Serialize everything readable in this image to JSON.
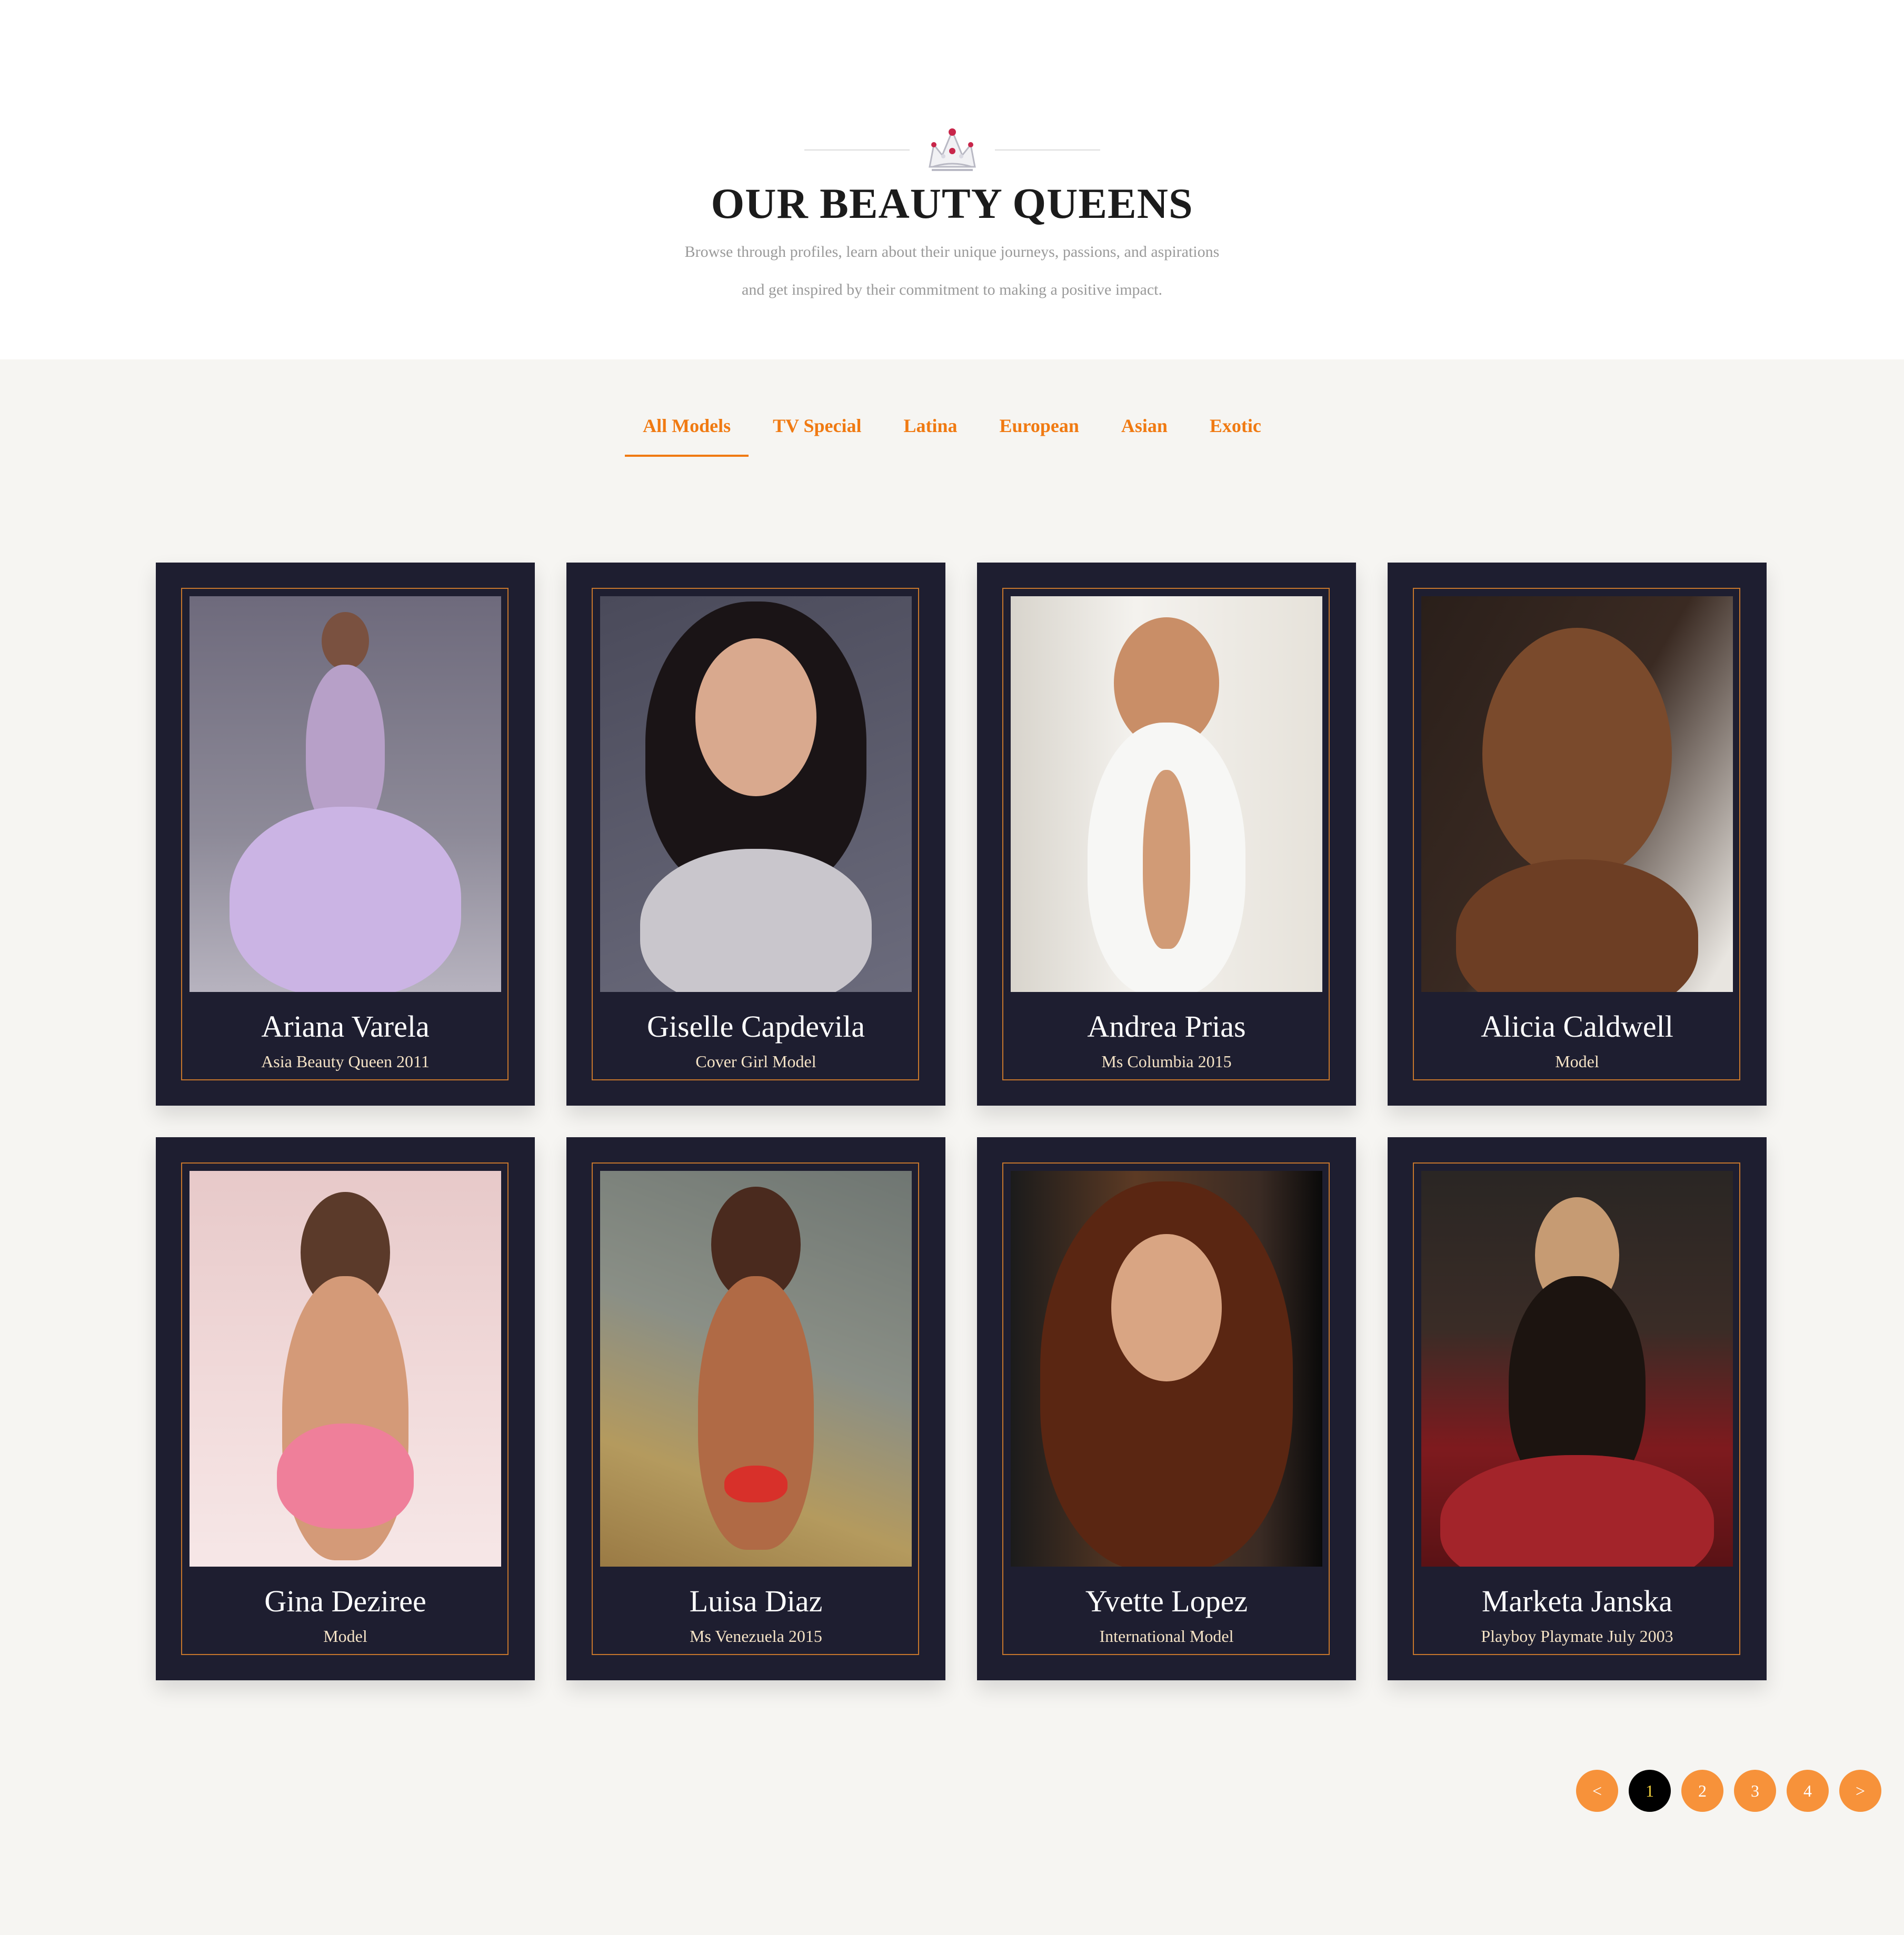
{
  "header": {
    "title": "OUR BEAUTY QUEENS",
    "subtitle_line1": "Browse through profiles, learn about their unique journeys, passions, and aspirations",
    "subtitle_line2": "and get inspired by their commitment to making a positive impact.",
    "icon": "crown-icon"
  },
  "filters": [
    {
      "label": "All Models",
      "active": true
    },
    {
      "label": "TV Special",
      "active": false
    },
    {
      "label": "Latina",
      "active": false
    },
    {
      "label": "European",
      "active": false
    },
    {
      "label": "Asian",
      "active": false
    },
    {
      "label": "Exotic",
      "active": false
    }
  ],
  "models": [
    {
      "name": "Ariana Varela",
      "role": "Asia Beauty Queen 2011"
    },
    {
      "name": "Giselle Capdevila",
      "role": "Cover Girl Model"
    },
    {
      "name": "Andrea Prias",
      "role": "Ms Columbia 2015"
    },
    {
      "name": "Alicia Caldwell",
      "role": "Model"
    },
    {
      "name": "Gina Deziree",
      "role": "Model"
    },
    {
      "name": "Luisa Diaz",
      "role": "Ms Venezuela 2015"
    },
    {
      "name": "Yvette Lopez",
      "role": "International Model"
    },
    {
      "name": "Marketa Janska",
      "role": "Playboy Playmate July 2003"
    }
  ],
  "pagination": {
    "prev": "<",
    "pages": [
      "1",
      "2",
      "3",
      "4"
    ],
    "current": "1",
    "next": ">"
  },
  "colors": {
    "accent": "#f07a12",
    "card_background": "#1e1e30",
    "card_frame": "#c6762c",
    "pager_button": "#f7923a",
    "pager_current": "#000000"
  }
}
